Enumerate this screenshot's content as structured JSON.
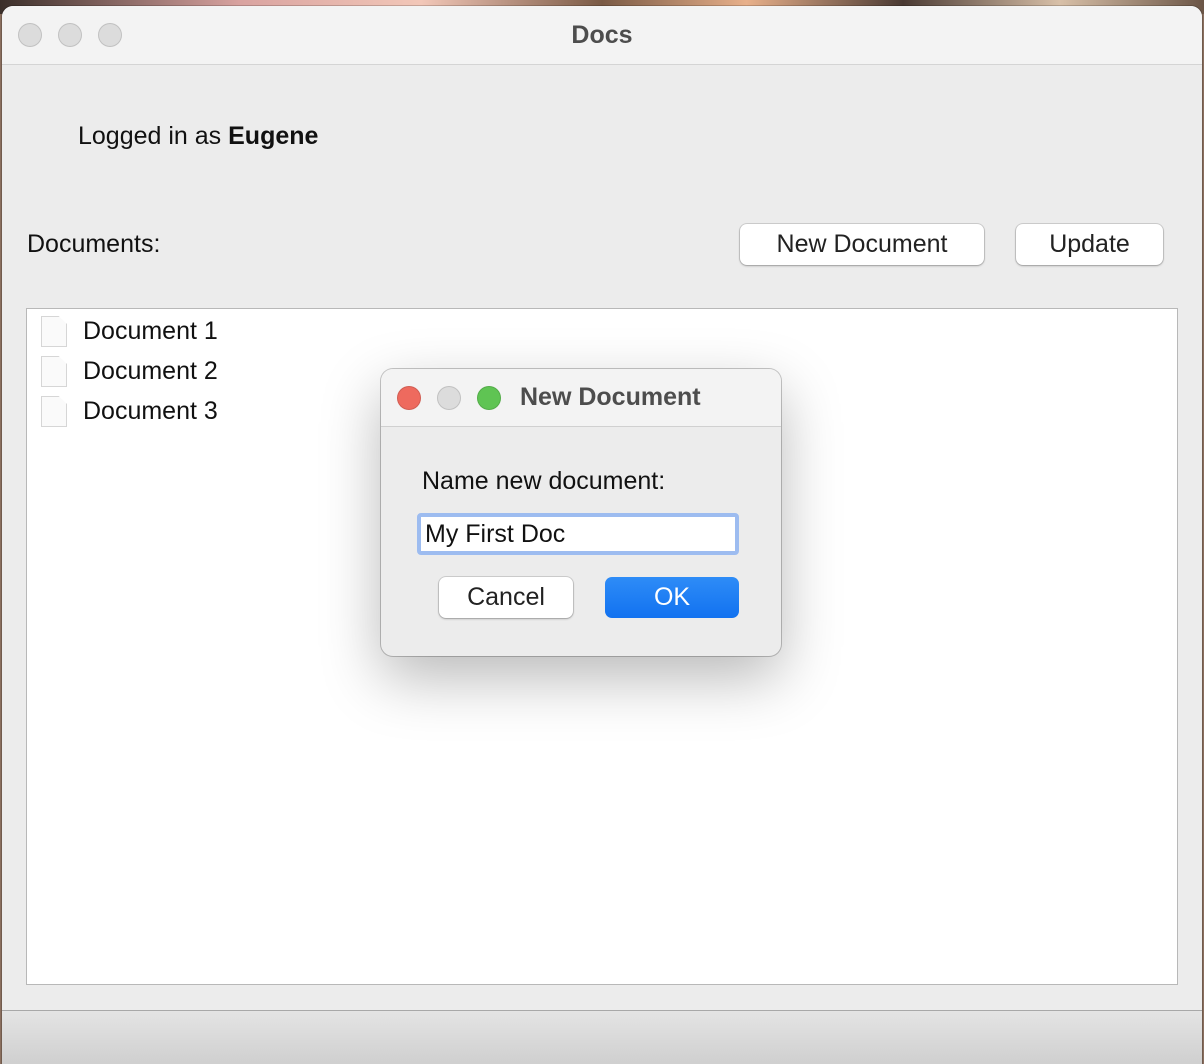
{
  "window": {
    "title": "Docs"
  },
  "session": {
    "prefix": "Logged in as ",
    "user": "Eugene"
  },
  "documents": {
    "label": "Documents:",
    "new_button": "New Document",
    "update_button": "Update",
    "items": [
      {
        "label": "Document 1"
      },
      {
        "label": "Document 2"
      },
      {
        "label": "Document 3"
      }
    ]
  },
  "dialog": {
    "title": "New Document",
    "prompt": "Name new document:",
    "input_value": "My First Doc",
    "cancel_label": "Cancel",
    "ok_label": "OK"
  },
  "colors": {
    "close": "#ee6a5e",
    "minimize": "#dcdcdc",
    "zoom": "#5fc453",
    "accent": "#1a7cf5",
    "focus_ring": "#9dbcf0"
  },
  "icons": [
    "document-icon"
  ]
}
